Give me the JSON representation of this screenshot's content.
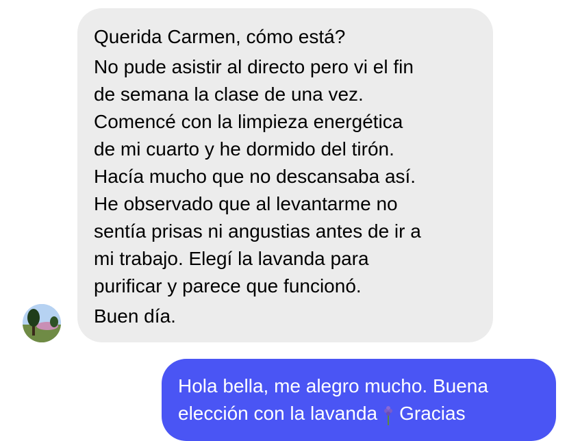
{
  "thread": {
    "incoming": {
      "greeting": "Querida Carmen, cómo está?",
      "lines": [
        "No pude asistir al directo pero vi el fin",
        "de semana la clase de una vez.",
        "Comencé con la limpieza energética",
        "de mi cuarto y he dormido del tirón.",
        "Hacía mucho que no descansaba así.",
        "He observado que al levantarme no",
        "sentía prisas ni angustias antes de ir a",
        "mi trabajo. Elegí la lavanda para",
        "purificar y parece que funcionó."
      ],
      "signoff": "Buen día."
    },
    "outgoing": {
      "line1": "Hola bella, me alegro mucho. Buena",
      "line2_start": "elección con la lavanda",
      "emoji": "lavender-emoji-icon",
      "line2_end": "Gracias"
    }
  },
  "colors": {
    "incoming_bubble": "#ececec",
    "outgoing_bubble": "#4a55f4",
    "text": "#000000",
    "outgoing_text": "#ffffff"
  }
}
